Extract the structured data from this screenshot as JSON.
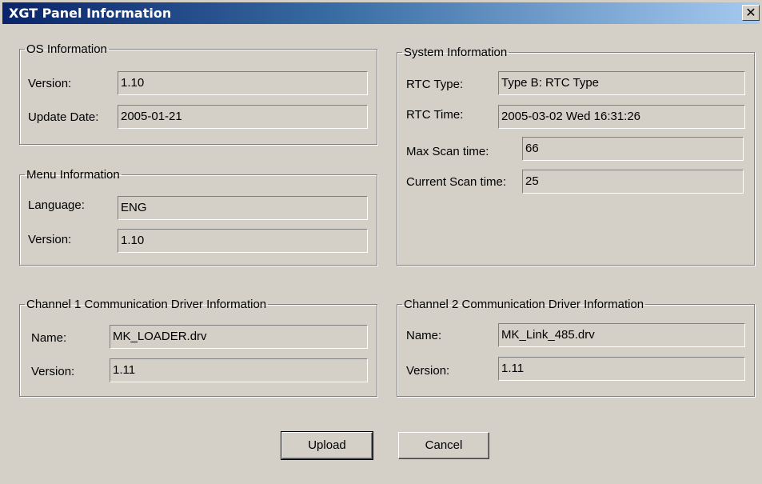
{
  "window": {
    "title": "XGT Panel Information",
    "close_glyph": "✕"
  },
  "os_info": {
    "legend": "OS Information",
    "version_label": "Version:",
    "version_value": "1.10",
    "update_label": "Update Date:",
    "update_value": "2005-01-21"
  },
  "menu_info": {
    "legend": "Menu Information",
    "language_label": "Language:",
    "language_value": "ENG",
    "version_label": "Version:",
    "version_value": "1.10"
  },
  "system_info": {
    "legend": "System Information",
    "rtc_type_label": "RTC Type:",
    "rtc_type_value": "Type B: RTC Type",
    "rtc_time_label": "RTC Time:",
    "rtc_time_value": "2005-03-02 Wed 16:31:26",
    "max_scan_label": "Max Scan time:",
    "max_scan_value": "66",
    "cur_scan_label": "Current Scan time:",
    "cur_scan_value": "25"
  },
  "channel1": {
    "legend": "Channel 1 Communication Driver Information",
    "name_label": "Name:",
    "name_value": "MK_LOADER.drv",
    "version_label": "Version:",
    "version_value": "1.11"
  },
  "channel2": {
    "legend": "Channel 2 Communication Driver Information",
    "name_label": "Name:",
    "name_value": "MK_Link_485.drv",
    "version_label": "Version:",
    "version_value": "1.11"
  },
  "buttons": {
    "upload": "Upload",
    "cancel": "Cancel"
  }
}
